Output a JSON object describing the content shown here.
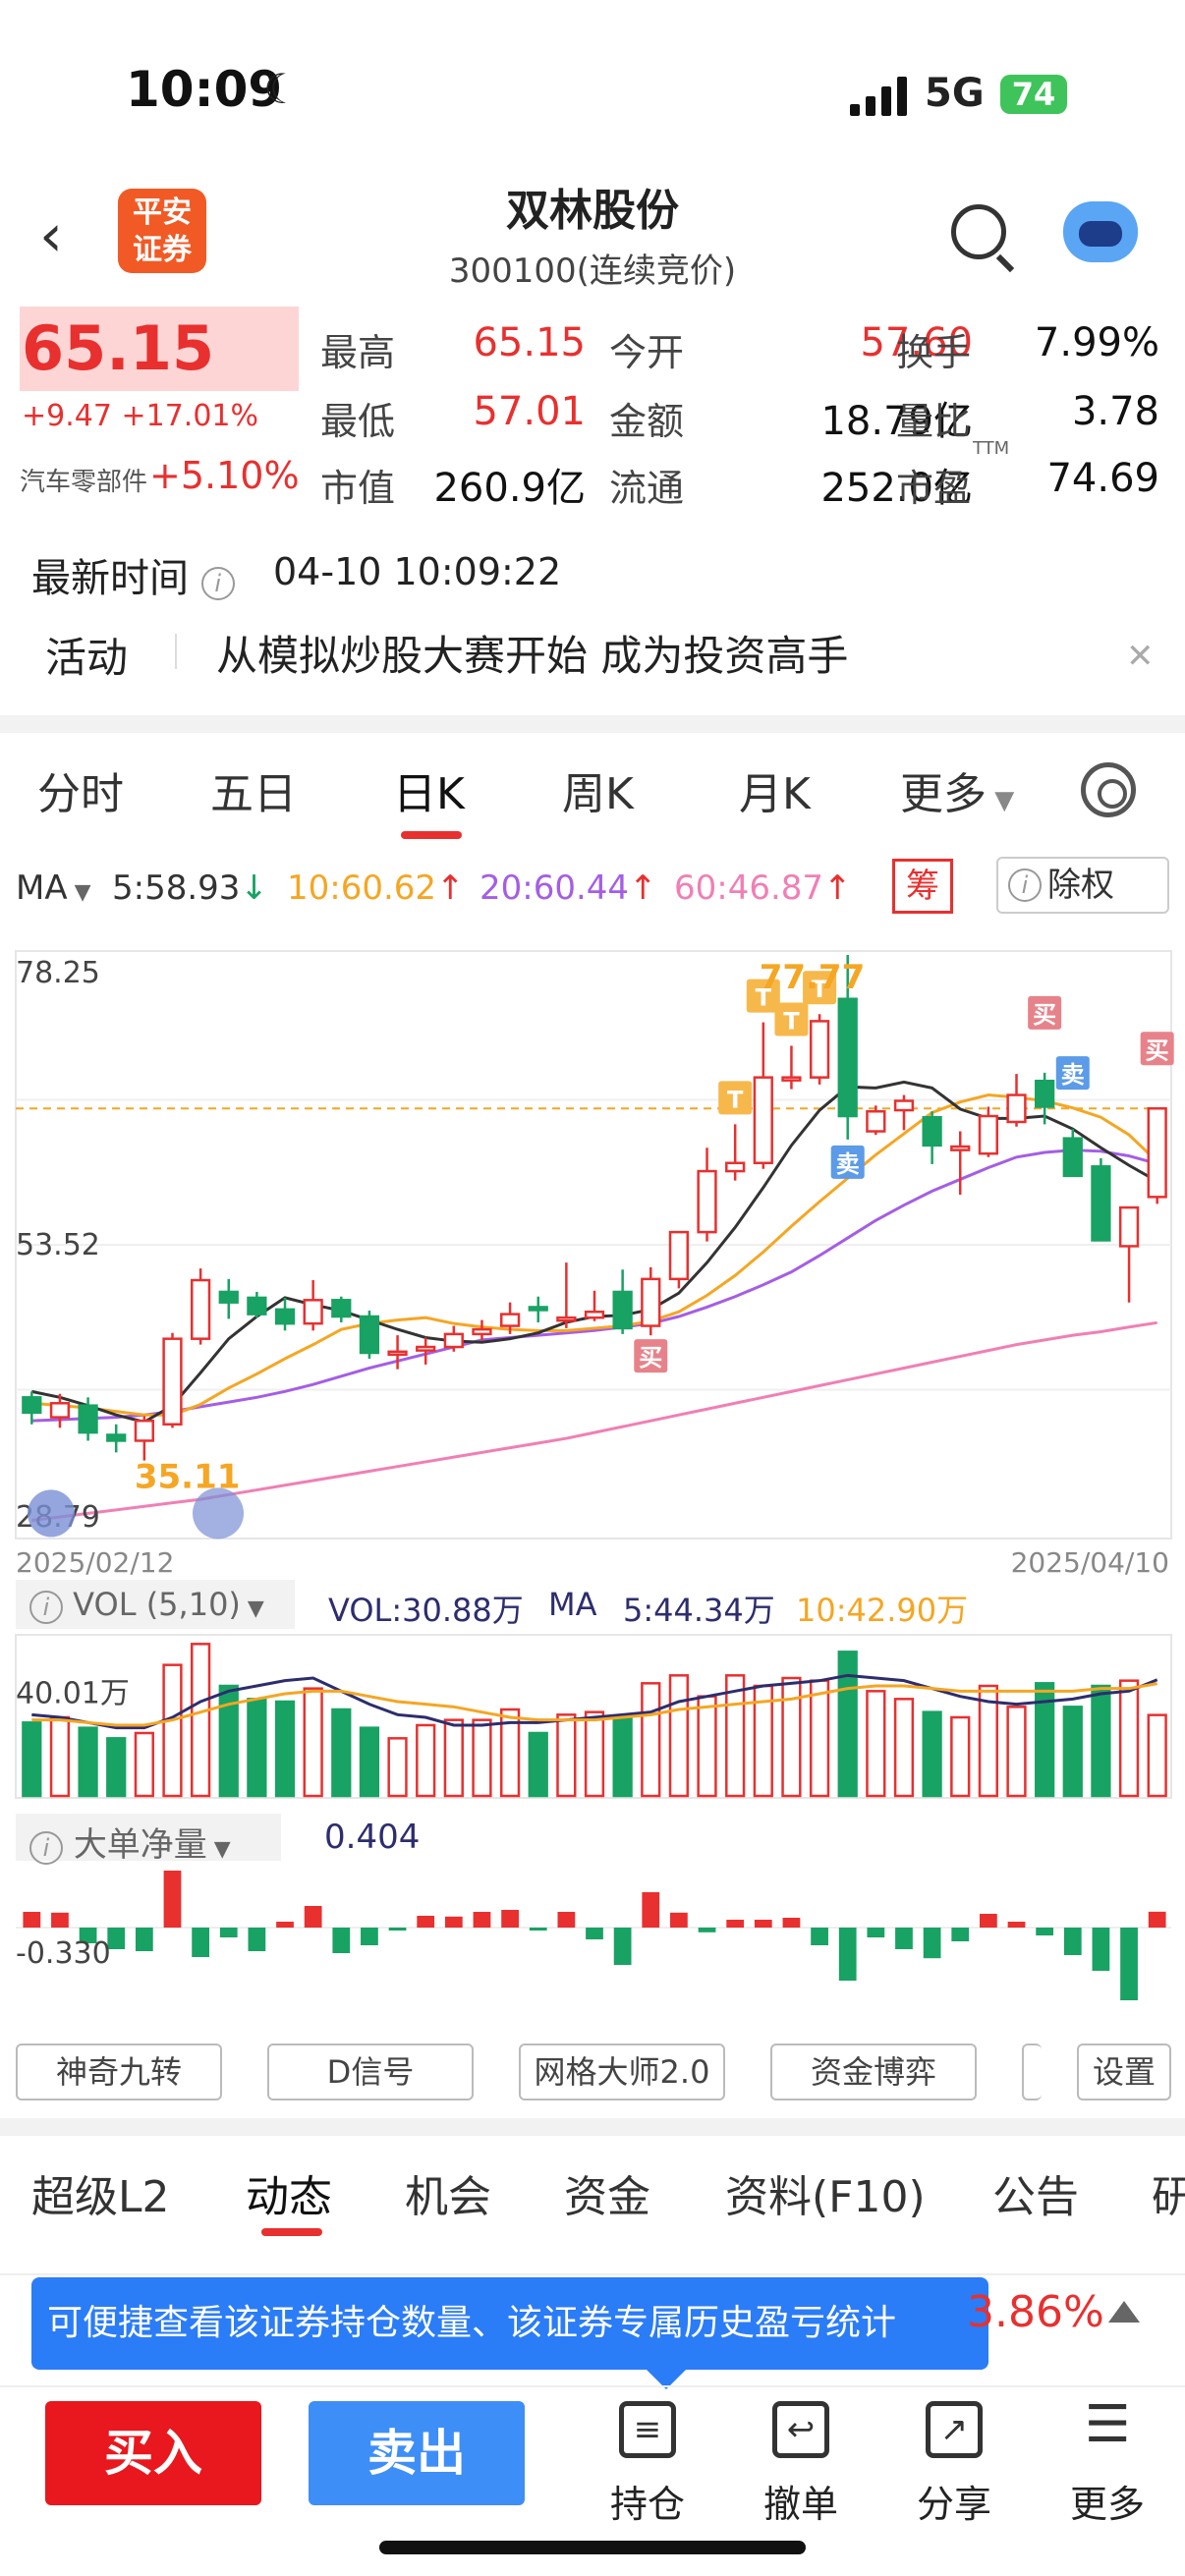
{
  "status": {
    "time": "10:09",
    "network": "5G",
    "battery": "74"
  },
  "header": {
    "broker_logo": "平安\n证券",
    "name": "双林股份",
    "code": "300100(连续竞价)"
  },
  "quote": {
    "price": "65.15",
    "change": "+9.47 +17.01%",
    "sector_name": "汽车零部件",
    "sector_change": "+5.10%",
    "rows": [
      [
        {
          "l": "最高",
          "v": "65.15",
          "c": "red"
        },
        {
          "l": "今开",
          "v": "57.60",
          "c": "red"
        },
        {
          "l": "换手",
          "v": "7.99%",
          "c": "dark"
        }
      ],
      [
        {
          "l": "最低",
          "v": "57.01",
          "c": "red"
        },
        {
          "l": "金额",
          "v": "18.79亿",
          "c": "dark"
        },
        {
          "l": "量比",
          "v": "3.78",
          "c": "dark"
        }
      ],
      [
        {
          "l": "市值",
          "v": "260.9亿",
          "c": "dark"
        },
        {
          "l": "流通",
          "v": "252.0亿",
          "c": "dark"
        },
        {
          "l": "市盈",
          "v": "74.69",
          "c": "dark",
          "sup": "TTM"
        }
      ]
    ]
  },
  "latest": {
    "label": "最新时间",
    "time": "04-10 10:09:22"
  },
  "activity": {
    "label": "活动",
    "text": "从模拟炒股大赛开始 成为投资高手"
  },
  "tabs": [
    "分时",
    "五日",
    "日K",
    "周K",
    "月K",
    "更多"
  ],
  "ma": {
    "label": "MA",
    "ma5": "5:58.93",
    "ma10": "10:60.62",
    "ma20": "20:60.44",
    "ma60": "60:46.87",
    "chou": "筹",
    "chuquan": "除权"
  },
  "chart_data": {
    "type": "candlestick",
    "date_start": "2025/02/12",
    "date_end": "2025/04/10",
    "y_top_label": "78.25",
    "y_mid_label": "53.52",
    "y_bottom_label": "28.79",
    "high_annotation": "77.77",
    "low_annotation": "35.11",
    "ohlc": [
      [
        40.5,
        41.0,
        38.2,
        39.2
      ],
      [
        38.8,
        40.8,
        37.9,
        40.0
      ],
      [
        39.8,
        40.5,
        36.8,
        37.5
      ],
      [
        37.3,
        38.2,
        35.8,
        36.8
      ],
      [
        36.8,
        38.9,
        35.11,
        38.5
      ],
      [
        38.2,
        46.0,
        37.9,
        45.5
      ],
      [
        45.5,
        51.5,
        45.0,
        50.5
      ],
      [
        49.5,
        50.6,
        47.2,
        48.6
      ],
      [
        49.0,
        49.5,
        47.3,
        47.6
      ],
      [
        48.0,
        49.0,
        46.2,
        46.8
      ],
      [
        46.8,
        50.5,
        46.2,
        48.8
      ],
      [
        48.8,
        49.1,
        46.9,
        47.4
      ],
      [
        47.4,
        47.9,
        43.8,
        44.3
      ],
      [
        44.4,
        45.8,
        42.9,
        44.4
      ],
      [
        44.5,
        45.6,
        43.3,
        44.8
      ],
      [
        44.8,
        46.6,
        44.4,
        45.9
      ],
      [
        45.9,
        47.1,
        45.4,
        46.3
      ],
      [
        46.6,
        48.6,
        45.9,
        47.6
      ],
      [
        48.2,
        49.1,
        46.9,
        48.1
      ],
      [
        47.3,
        52.0,
        46.4,
        47.3
      ],
      [
        47.3,
        49.6,
        47.0,
        47.8
      ],
      [
        49.5,
        51.4,
        45.9,
        46.4
      ],
      [
        46.6,
        51.6,
        45.8,
        50.6
      ],
      [
        50.6,
        54.2,
        49.8,
        54.6
      ],
      [
        54.6,
        61.8,
        53.8,
        59.8
      ],
      [
        59.8,
        63.8,
        59.0,
        60.5
      ],
      [
        60.5,
        72.5,
        60.0,
        67.8
      ],
      [
        67.8,
        70.5,
        66.8,
        67.8
      ],
      [
        67.8,
        73.2,
        67.2,
        72.6
      ],
      [
        74.5,
        78.25,
        62.5,
        64.5
      ],
      [
        63.2,
        65.4,
        62.9,
        64.9
      ],
      [
        65.0,
        66.3,
        63.3,
        65.8
      ],
      [
        64.4,
        64.9,
        60.4,
        62.0
      ],
      [
        61.6,
        63.2,
        57.8,
        61.9
      ],
      [
        61.3,
        65.3,
        61.0,
        64.5
      ],
      [
        64.0,
        68.1,
        63.6,
        66.3
      ],
      [
        67.5,
        68.2,
        63.8,
        65.3
      ],
      [
        62.6,
        63.4,
        59.6,
        59.4
      ],
      [
        60.2,
        60.9,
        54.4,
        53.9
      ],
      [
        53.4,
        55.8,
        48.6,
        56.7
      ],
      [
        57.6,
        65.15,
        57.01,
        65.15
      ]
    ],
    "ma5": [
      41.0,
      40.5,
      39.8,
      39.0,
      38.4,
      39.8,
      42.6,
      45.5,
      47.4,
      49.0,
      48.4,
      47.9,
      47.1,
      46.3,
      45.6,
      45.3,
      45.2,
      45.5,
      46.0,
      46.9,
      47.4,
      47.5,
      48.0,
      49.4,
      52.0,
      55.0,
      58.4,
      62.0,
      65.0,
      67.0,
      66.9,
      67.4,
      66.9,
      65.1,
      64.3,
      64.3,
      64.5,
      63.4,
      61.8,
      60.3,
      58.93
    ],
    "ma10": [
      40.0,
      39.8,
      39.6,
      39.3,
      39.0,
      39.0,
      39.9,
      41.3,
      42.5,
      43.8,
      45.0,
      46.3,
      46.8,
      47.1,
      47.3,
      46.8,
      46.5,
      46.3,
      46.2,
      46.2,
      46.4,
      46.6,
      47.0,
      47.8,
      49.2,
      50.9,
      52.9,
      55.1,
      57.2,
      59.2,
      61.2,
      63.0,
      64.8,
      65.7,
      66.3,
      66.1,
      65.8,
      65.2,
      64.4,
      62.9,
      60.62
    ],
    "ma20": [
      38.5,
      38.6,
      38.7,
      38.8,
      39.0,
      39.3,
      39.7,
      40.1,
      40.5,
      41.0,
      41.6,
      42.3,
      43.0,
      43.6,
      44.2,
      44.8,
      45.4,
      45.6,
      45.8,
      46.0,
      46.2,
      46.5,
      46.8,
      47.4,
      48.2,
      49.1,
      50.1,
      51.2,
      52.6,
      54.1,
      55.6,
      56.9,
      58.1,
      59.1,
      60.1,
      61.0,
      61.4,
      61.6,
      61.5,
      61.1,
      60.44
    ],
    "ma60": [
      30.0,
      30.3,
      30.6,
      30.9,
      31.2,
      31.5,
      31.8,
      32.2,
      32.6,
      33.0,
      33.4,
      33.8,
      34.2,
      34.6,
      35.0,
      35.4,
      35.8,
      36.2,
      36.6,
      37.0,
      37.5,
      38.0,
      38.5,
      39.0,
      39.5,
      40.0,
      40.5,
      41.0,
      41.5,
      42.0,
      42.5,
      43.0,
      43.5,
      44.0,
      44.5,
      45.0,
      45.4,
      45.8,
      46.1,
      46.5,
      46.87
    ],
    "markers": [
      {
        "i": 22,
        "text": "买",
        "side": "below"
      },
      {
        "i": 25,
        "text": "T"
      },
      {
        "i": 26,
        "text": "T"
      },
      {
        "i": 27,
        "text": "T"
      },
      {
        "i": 28,
        "text": "T"
      },
      {
        "i": 29,
        "text": "卖",
        "side": "below"
      },
      {
        "i": 36,
        "text": "买",
        "side": "above"
      },
      {
        "i": 37,
        "text": "卖",
        "side": "above"
      },
      {
        "i": 40,
        "text": "买",
        "side": "above"
      }
    ],
    "volume": [
      28.0,
      30.0,
      26.0,
      22.0,
      24.0,
      50.0,
      58.0,
      42.0,
      37.0,
      36.0,
      41.0,
      33.0,
      26.0,
      22.0,
      27.0,
      29.0,
      29.0,
      33.0,
      24.0,
      31.0,
      32.0,
      30.0,
      43.0,
      46.0,
      38.0,
      46.0,
      42.0,
      45.0,
      44.0,
      55.0,
      40.0,
      37.0,
      32.0,
      30.0,
      42.0,
      34.0,
      43.0,
      34.0,
      42.0,
      44.0,
      30.88
    ],
    "vol_ma5": [
      31.0,
      30.0,
      28.0,
      26.0,
      26.0,
      30.0,
      36.0,
      40.0,
      42.0,
      44.0,
      45.0,
      40.0,
      35.0,
      31.0,
      30.0,
      27.0,
      27.0,
      28.0,
      28.0,
      29.0,
      30.0,
      31.0,
      32.0,
      36.0,
      38.0,
      40.0,
      42.0,
      43.0,
      44.0,
      46.0,
      45.0,
      44.0,
      41.0,
      38.0,
      36.0,
      35.0,
      36.0,
      37.0,
      39.0,
      40.0,
      44.34
    ],
    "vol_ma10": [
      29.0,
      29.0,
      28.0,
      27.0,
      27.0,
      29.0,
      32.0,
      35.0,
      37.0,
      39.0,
      40.0,
      40.0,
      38.0,
      36.0,
      35.0,
      34.0,
      32.0,
      30.0,
      29.0,
      29.0,
      29.0,
      30.0,
      31.0,
      33.0,
      34.0,
      35.0,
      36.0,
      37.0,
      39.0,
      41.0,
      42.0,
      42.0,
      41.0,
      40.0,
      40.0,
      40.0,
      40.0,
      40.0,
      41.0,
      41.0,
      42.9
    ],
    "vol_axis_label": "40.01万",
    "netflow": [
      0.4,
      0.38,
      -0.4,
      -0.55,
      -0.6,
      1.45,
      -0.75,
      -0.25,
      -0.6,
      0.15,
      0.55,
      -0.65,
      -0.45,
      -0.05,
      0.3,
      0.28,
      0.4,
      0.45,
      -0.05,
      0.4,
      -0.3,
      -0.95,
      0.9,
      0.38,
      -0.12,
      0.2,
      0.2,
      0.25,
      -0.45,
      -1.35,
      -0.25,
      -0.55,
      -0.78,
      -0.35,
      0.35,
      0.15,
      -0.2,
      -0.7,
      -1.1,
      -1.85,
      0.404
    ],
    "netflow_axis_label": "-0.330"
  },
  "vol": {
    "label": "VOL (5,10)",
    "vol": "VOL:30.88万",
    "ma": "MA",
    "ma5": "5:44.34万",
    "ma10": "10:42.90万"
  },
  "netflow": {
    "label": "大单净量",
    "value": "0.404"
  },
  "indicator_buttons": [
    "神奇九转",
    "D信号",
    "网格大师2.0",
    "资金博弈",
    "设置"
  ],
  "bottom_tabs": [
    "超级L2",
    "动态",
    "机会",
    "资金",
    "资料(F10)",
    "公告",
    "研"
  ],
  "tooltip": {
    "text": "可便捷查看该证券持仓数量、该证券专属历史盈亏统计",
    "pct": "3.86%"
  },
  "footer": {
    "buy": "买入",
    "sell": "卖出",
    "items": [
      {
        "label": "持仓",
        "icon": "holdings-icon"
      },
      {
        "label": "撤单",
        "icon": "cancel-order-icon"
      },
      {
        "label": "分享",
        "icon": "share-icon"
      },
      {
        "label": "更多",
        "icon": "more-icon"
      }
    ]
  },
  "colors": {
    "up": "#e8302f",
    "down": "#18a263",
    "ma5": "#333333",
    "ma10": "#f5a623",
    "ma20": "#a45ee5",
    "ma60": "#f07fb5",
    "accent": "#2b7cf7"
  }
}
